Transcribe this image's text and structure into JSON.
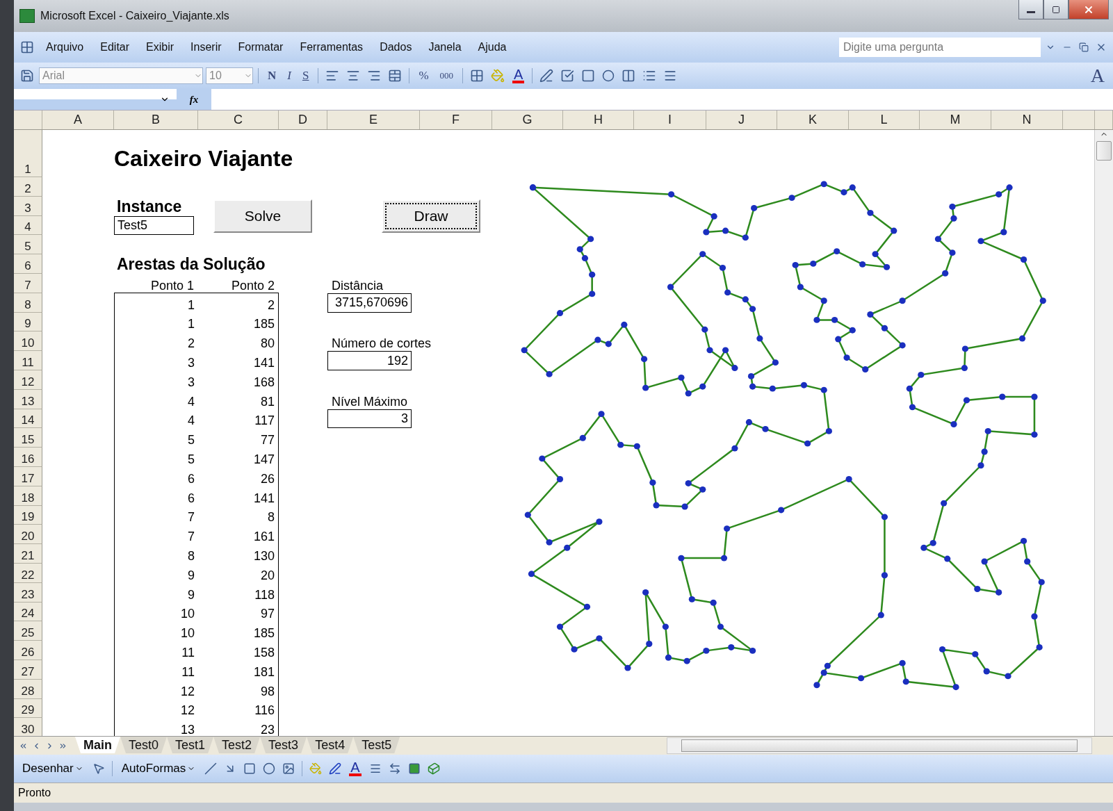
{
  "window": {
    "title": "Microsoft Excel - Caixeiro_Viajante.xls"
  },
  "menu": [
    "Arquivo",
    "Editar",
    "Exibir",
    "Inserir",
    "Formatar",
    "Ferramentas",
    "Dados",
    "Janela",
    "Ajuda"
  ],
  "help_search": {
    "placeholder": "Digite uma pergunta"
  },
  "formatting_toolbar": {
    "font": "Arial",
    "size": "10",
    "bold": "N",
    "italic": "I",
    "underline": "S",
    "percent": "%",
    "thousands": "000",
    "font_color": "A",
    "big_letter": "A"
  },
  "formula_bar": {
    "fx": "fx"
  },
  "columns": [
    "A",
    "B",
    "C",
    "D",
    "E",
    "F",
    "G",
    "H",
    "I",
    "J",
    "K",
    "L",
    "M",
    "N"
  ],
  "rows": [
    "1",
    "2",
    "3",
    "4",
    "5",
    "6",
    "7",
    "8",
    "9",
    "10",
    "11",
    "12",
    "13",
    "14",
    "15",
    "16",
    "17",
    "18",
    "19",
    "20",
    "21",
    "22",
    "23",
    "24",
    "25",
    "26",
    "27",
    "28",
    "29",
    "30"
  ],
  "sheet": {
    "title": "Caixeiro Viajante",
    "instance_label": "Instance",
    "instance_value": "Test5",
    "buttons": [
      {
        "label": "Solve",
        "focused": false
      },
      {
        "label": "Draw",
        "focused": true
      }
    ],
    "edges_title": "Arestas da Solução",
    "edges_columns": [
      "Ponto 1",
      "Ponto 2"
    ],
    "edges": [
      [
        "1",
        "2"
      ],
      [
        "1",
        "185"
      ],
      [
        "2",
        "80"
      ],
      [
        "3",
        "141"
      ],
      [
        "3",
        "168"
      ],
      [
        "4",
        "81"
      ],
      [
        "4",
        "117"
      ],
      [
        "5",
        "77"
      ],
      [
        "5",
        "147"
      ],
      [
        "6",
        "26"
      ],
      [
        "6",
        "141"
      ],
      [
        "7",
        "8"
      ],
      [
        "7",
        "161"
      ],
      [
        "8",
        "130"
      ],
      [
        "9",
        "20"
      ],
      [
        "9",
        "118"
      ],
      [
        "10",
        "97"
      ],
      [
        "10",
        "185"
      ],
      [
        "11",
        "158"
      ],
      [
        "11",
        "181"
      ],
      [
        "12",
        "98"
      ],
      [
        "12",
        "116"
      ],
      [
        "13",
        "23"
      ]
    ],
    "stats": [
      {
        "label": "Distância",
        "value": "3715,670696"
      },
      {
        "label": "Número de cortes",
        "value": "192"
      },
      {
        "label": "Nível Máximo",
        "value": "3"
      }
    ]
  },
  "sheet_tabs": [
    {
      "label": "Main",
      "selected": true
    },
    {
      "label": "Test0",
      "selected": false
    },
    {
      "label": "Test1",
      "selected": false
    },
    {
      "label": "Test2",
      "selected": false
    },
    {
      "label": "Test3",
      "selected": false
    },
    {
      "label": "Test4",
      "selected": false
    },
    {
      "label": "Test5",
      "selected": false
    }
  ],
  "drawing_toolbar": {
    "draw": "Desenhar",
    "autoshapes": "AutoFormas",
    "font_color": "A"
  },
  "status_bar": {
    "text": "Pronto"
  }
}
